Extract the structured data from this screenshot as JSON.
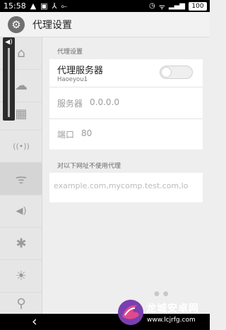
{
  "status_bar": {
    "time": "15:58",
    "battery": "100"
  },
  "header": {
    "title": "代理设置",
    "icon": "gear-icon"
  },
  "sidebar": {
    "items": [
      {
        "icon": "home-icon",
        "glyph": "⌂"
      },
      {
        "icon": "cloud-icon",
        "glyph": "☁"
      },
      {
        "icon": "apps-grid-icon",
        "glyph": "▦"
      },
      {
        "icon": "hotspot-icon",
        "glyph": "((•))"
      },
      {
        "icon": "wifi-icon",
        "glyph": "ᯤ",
        "active": true
      },
      {
        "icon": "volume-icon",
        "glyph": "◀)"
      },
      {
        "icon": "bluetooth-icon",
        "glyph": "✱"
      },
      {
        "icon": "brightness-icon",
        "glyph": "☀"
      },
      {
        "icon": "location-lock-icon",
        "glyph": "⚲"
      }
    ]
  },
  "volume": {
    "level": 1.0
  },
  "proxy_settings": {
    "section_header": "代理设置",
    "proxy_server": {
      "title": "代理服务器",
      "subtitle": "Haoeyou1",
      "enabled": false
    },
    "server": {
      "label": "服务器",
      "value": "0.0.0.0"
    },
    "port": {
      "label": "端口",
      "value": "80"
    }
  },
  "bypass": {
    "section_header": "对以下网址不使用代理",
    "placeholder": "example.com,mycomp.test.com,lo"
  },
  "navigation": {
    "back_icon": "back-arrow-icon"
  },
  "watermark": {
    "text": "龙城安卓网",
    "url": "www.lcjrfg.com"
  }
}
